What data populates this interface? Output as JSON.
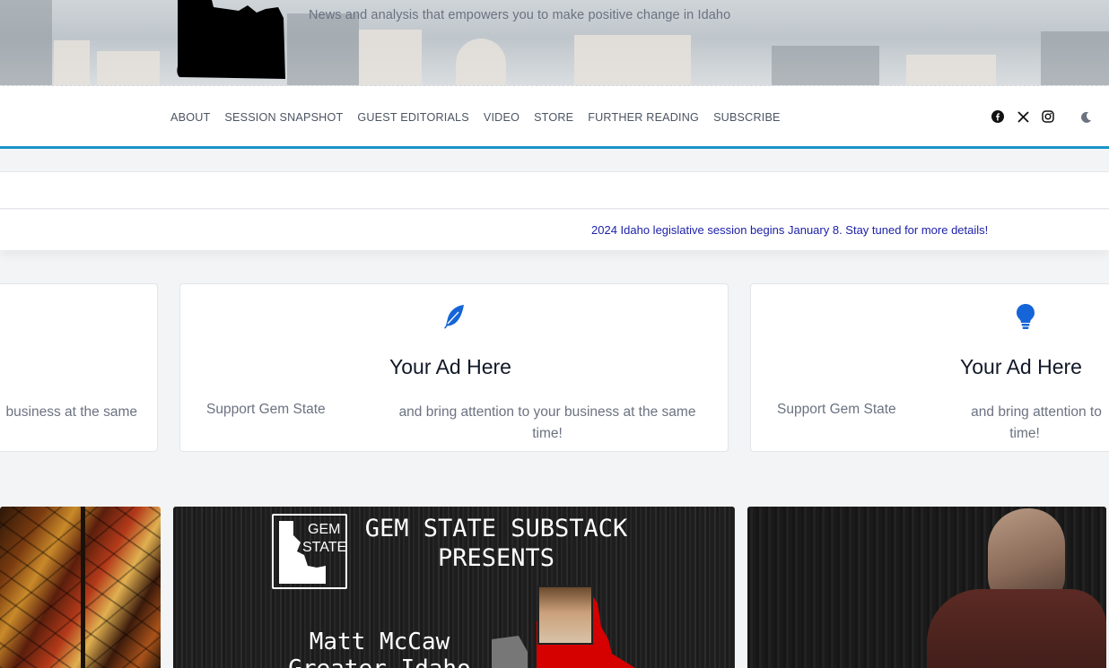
{
  "header": {
    "tagline": "News and analysis that empowers you to make positive change in Idaho"
  },
  "nav": {
    "items": [
      "ABOUT",
      "SESSION SNAPSHOT",
      "GUEST EDITORIALS",
      "VIDEO",
      "STORE",
      "FURTHER READING",
      "SUBSCRIBE"
    ],
    "social": [
      "facebook-icon",
      "x-icon",
      "instagram-icon"
    ],
    "theme_toggle": "moon-icon"
  },
  "ticker": {
    "text": "2024 Idaho legislative session begins January 8. Stay tuned for more details!"
  },
  "ads": [
    {
      "icon": "none",
      "title": "",
      "left_text": "",
      "right_text": "business at the same"
    },
    {
      "icon": "feather-icon",
      "title": "Your Ad Here",
      "left_text": "Support Gem State",
      "right_text_line1": "and bring attention to your business at the same",
      "right_text_line2": "time!"
    },
    {
      "icon": "lightbulb-icon",
      "title": "Your Ad Here",
      "left_text": "Support Gem State",
      "right_text_line1": "and bring attention to",
      "right_text_line2": "time!"
    }
  ],
  "posts": {
    "promo": {
      "badge_line1": "GEM",
      "badge_line2": "STATE",
      "headline_line1": "GEM STATE SUBSTACK",
      "headline_line2": "PRESENTS",
      "name_line1": "Matt McCaw",
      "name_line2": "Greater Idaho"
    }
  },
  "colors": {
    "accent": "#1a93c9",
    "icon_blue": "#1565d8",
    "ticker": "#1e22a8"
  }
}
